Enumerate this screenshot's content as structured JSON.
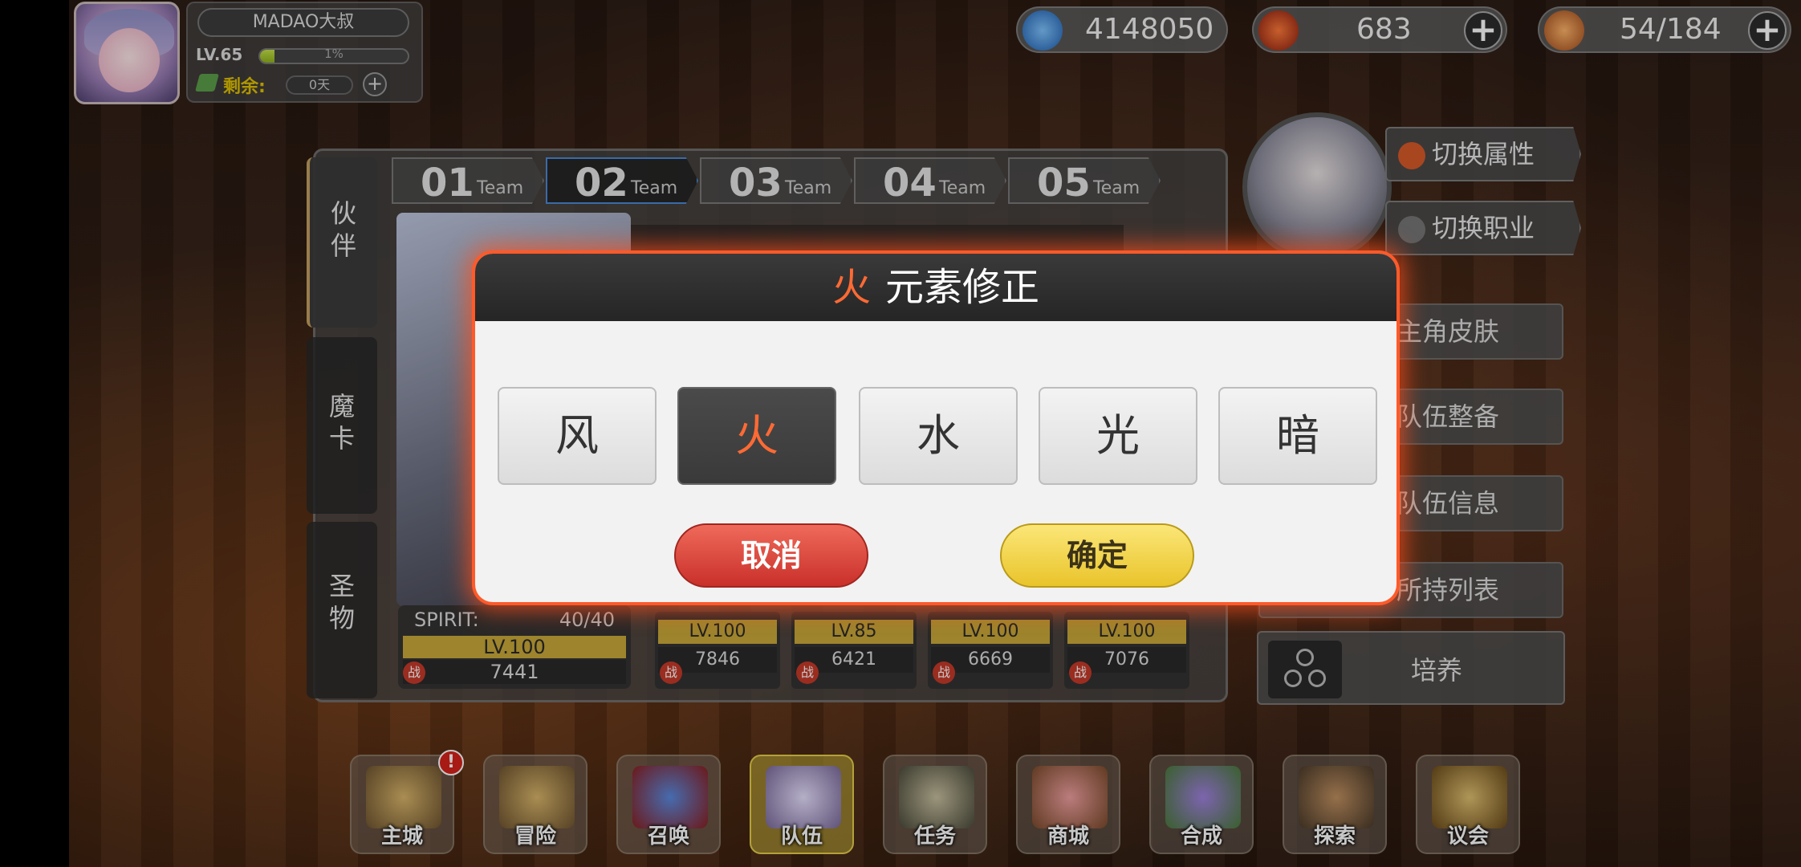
{
  "profile": {
    "name": "MADAO大叔",
    "level": "LV.65",
    "exp_progress": 0.1,
    "exp_text": "1%",
    "remain_label": "剩余:",
    "remain_value": "0天",
    "add_symbol": "+"
  },
  "currencies": [
    {
      "icon": "blue-crystal-icon",
      "value": "4148050",
      "plus": ""
    },
    {
      "icon": "red-gem-icon",
      "value": "683",
      "plus": "+"
    },
    {
      "icon": "stamina-food-icon",
      "value": "54/184",
      "plus": "+"
    }
  ],
  "side_tabs": [
    "伙伴",
    "魔卡",
    "圣物"
  ],
  "teams": [
    {
      "num": "01",
      "label": "Team"
    },
    {
      "num": "02",
      "label": "Team"
    },
    {
      "num": "03",
      "label": "Team"
    },
    {
      "num": "04",
      "label": "Team"
    },
    {
      "num": "05",
      "label": "Team"
    }
  ],
  "selected_team_index": 1,
  "leader": {
    "spirit_label": "SPIRIT:",
    "spirit_value": "40/40",
    "level": "LV.100",
    "power": "7441",
    "battle_mark": "战"
  },
  "members": [
    {
      "level": "LV.100",
      "power": "7846"
    },
    {
      "level": "LV.85",
      "power": "6421"
    },
    {
      "level": "LV.100",
      "power": "6669"
    },
    {
      "level": "LV.100",
      "power": "7076"
    }
  ],
  "right_panel": {
    "switch_attribute": "切换属性",
    "switch_class": "切换职业",
    "buttons": [
      "主角皮肤",
      "队伍整备",
      "队伍信息",
      "所持列表"
    ],
    "train": "培养"
  },
  "bottom_nav": [
    {
      "label": "主城",
      "badge": "!"
    },
    {
      "label": "冒险"
    },
    {
      "label": "召唤"
    },
    {
      "label": "队伍"
    },
    {
      "label": "任务"
    },
    {
      "label": "商城"
    },
    {
      "label": "合成"
    },
    {
      "label": "探索"
    },
    {
      "label": "议会"
    }
  ],
  "dialog": {
    "title_element": "火",
    "title_text": "元素修正",
    "elements": [
      "风",
      "火",
      "水",
      "光",
      "暗"
    ],
    "selected_element": "火",
    "cancel": "取消",
    "confirm": "确定"
  },
  "colors": {
    "accent_fire": "#ff6a34",
    "cancel": "#d83a30",
    "confirm": "#f0cf3a",
    "dialog_glow": "#ff5a2a"
  }
}
